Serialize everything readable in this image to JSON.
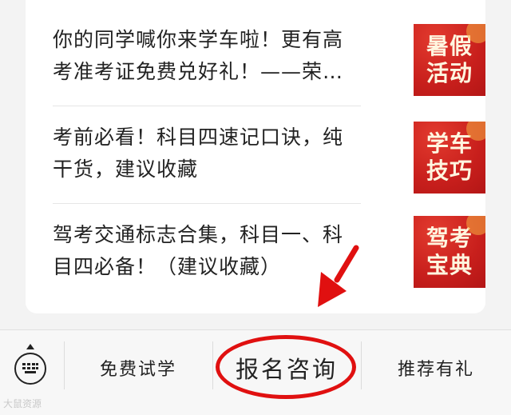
{
  "articles": [
    {
      "title": "你的同学喊你来学车啦！更有高考准考证免费兑好礼！——荣安...",
      "thumb_line1": "暑假",
      "thumb_line2": "活动"
    },
    {
      "title": "考前必看！科目四速记口诀，纯干货，建议收藏",
      "thumb_line1": "学车",
      "thumb_line2": "技巧"
    },
    {
      "title": "驾考交通标志合集，科目一、科目四必备！（建议收藏）",
      "thumb_line1": "驾考",
      "thumb_line2": "宝典"
    }
  ],
  "menu": {
    "keyboard_icon": "keyboard-icon",
    "items": [
      "免费试学",
      "报名咨询",
      "推荐有礼"
    ]
  },
  "annotation": {
    "color": "#e01010"
  },
  "colors": {
    "thumb_red": "#c81f1c",
    "thumb_text": "#fff6e0"
  },
  "watermark": "大鼠资源"
}
